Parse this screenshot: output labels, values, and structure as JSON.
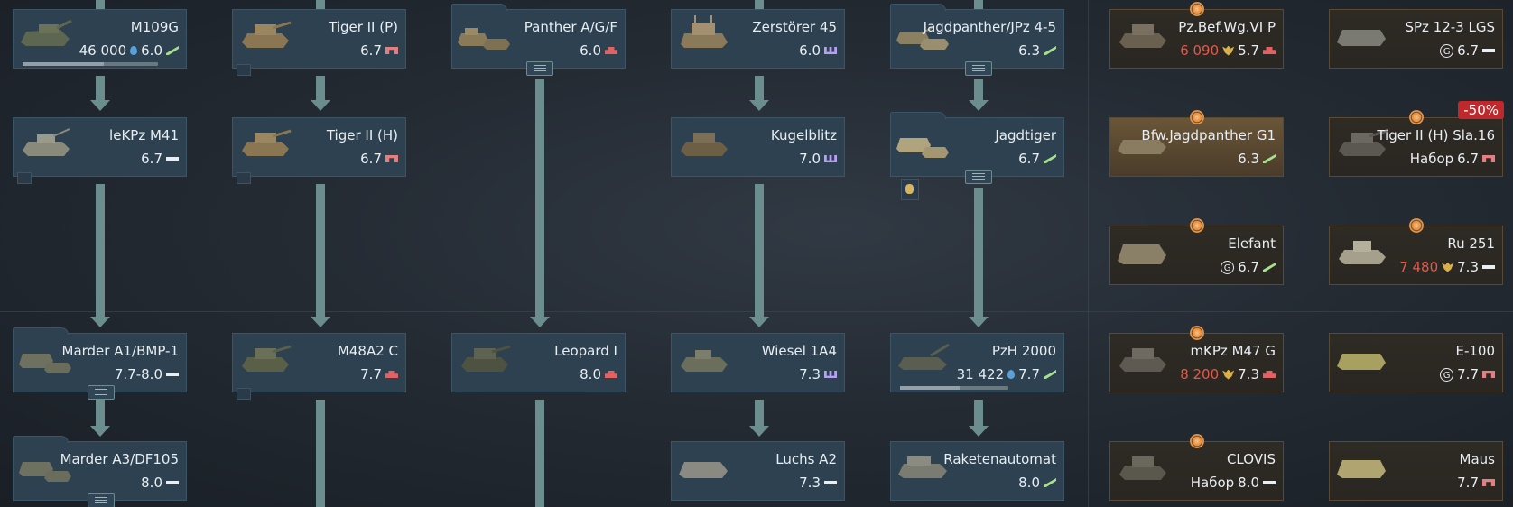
{
  "screen": "War Thunder research tree - Germany ground vehicles",
  "vehicles": [
    {
      "id": "m109g",
      "name": "M109G",
      "br": "6.0",
      "type": "td",
      "cost": "46 000",
      "cost_icon": "rp-icon",
      "progress": 0.6
    },
    {
      "id": "tiger2p",
      "name": "Tiger II (P)",
      "br": "6.7",
      "type": "heavy"
    },
    {
      "id": "panther",
      "name": "Panther A/G/F",
      "br": "6.0",
      "type": "medium",
      "folder": true
    },
    {
      "id": "zerst45",
      "name": "Zerstörer 45",
      "br": "6.0",
      "type": "spaa"
    },
    {
      "id": "jagdpanther",
      "name": "Jagdpanther/JPz 4-5",
      "br": "6.3",
      "type": "td",
      "folder": true
    },
    {
      "id": "lekpz",
      "name": "leKPz M41",
      "br": "6.7",
      "type": "light"
    },
    {
      "id": "tiger2h",
      "name": "Tiger II (H)",
      "br": "6.7",
      "type": "heavy"
    },
    {
      "id": "kugelblitz",
      "name": "Kugelblitz",
      "br": "7.0",
      "type": "spaa"
    },
    {
      "id": "jagdtiger",
      "name": "Jagdtiger",
      "br": "6.7",
      "type": "td",
      "folder": true
    },
    {
      "id": "marder_a1",
      "name": "Marder A1/BMP-1",
      "br": "7.7-8.0",
      "type": "light",
      "folder": true
    },
    {
      "id": "m48a2c",
      "name": "M48A2 C",
      "br": "7.7",
      "type": "medium"
    },
    {
      "id": "leopard1",
      "name": "Leopard I",
      "br": "8.0",
      "type": "medium"
    },
    {
      "id": "wiesel",
      "name": "Wiesel 1A4",
      "br": "7.3",
      "type": "spaa"
    },
    {
      "id": "pzh2000",
      "name": "PzH 2000",
      "br": "7.7",
      "type": "td",
      "cost": "31 422",
      "cost_icon": "rp-icon",
      "progress": 0.55
    },
    {
      "id": "marder_a3",
      "name": "Marder A3/DF105",
      "br": "8.0",
      "type": "light",
      "folder": true
    },
    {
      "id": "luchs",
      "name": "Luchs A2",
      "br": "7.3",
      "type": "light"
    },
    {
      "id": "raketen",
      "name": "Raketenautomat",
      "br": "8.0",
      "type": "td"
    }
  ],
  "premium": [
    {
      "id": "pzbefwg",
      "name": "Pz.Bef.Wg.VI P",
      "br": "5.7",
      "type": "medium",
      "cost": "6 090",
      "cost_icon": "eagle-icon"
    },
    {
      "id": "spz123",
      "name": "SPz 12-3 LGS",
      "br": "6.7",
      "type": "light",
      "ge": "G"
    },
    {
      "id": "bfwjagd",
      "name": "Bfw.Jagdpanther G1",
      "br": "6.3",
      "type": "td",
      "highlight": true
    },
    {
      "id": "tigerslа",
      "name": "Tiger II (H) Sla.16",
      "br": "6.7",
      "type": "heavy",
      "pack": "Набор",
      "discount": "-50%"
    },
    {
      "id": "elefant",
      "name": "Elefant",
      "br": "6.7",
      "type": "td",
      "ge": "G"
    },
    {
      "id": "ru251",
      "name": "Ru 251",
      "br": "7.3",
      "type": "light",
      "cost": "7 480",
      "cost_icon": "eagle-icon"
    },
    {
      "id": "mkpz",
      "name": "mKPz M47 G",
      "br": "7.3",
      "type": "medium",
      "cost": "8 200",
      "cost_icon": "eagle-icon"
    },
    {
      "id": "e100",
      "name": "E-100",
      "br": "7.7",
      "type": "heavy",
      "ge": "G"
    },
    {
      "id": "clovis",
      "name": "CLOVIS",
      "br": "8.0",
      "type": "light",
      "pack": "Набор"
    },
    {
      "id": "maus",
      "name": "Maus",
      "br": "7.7",
      "type": "heavy"
    }
  ],
  "colors": {
    "card_bg": "#2d4150",
    "premium_bg": "#2e2a24",
    "arrow": "#6b8d8e",
    "cost_red": "#e05a4a",
    "text": "#e8eef2"
  }
}
